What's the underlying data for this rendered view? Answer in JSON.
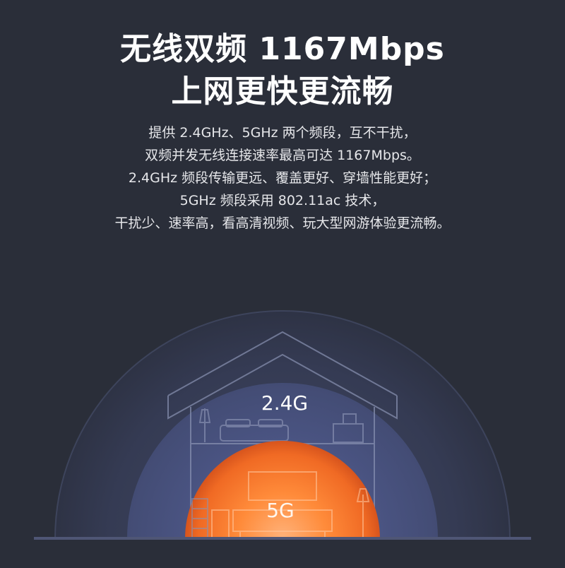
{
  "headline": {
    "line1": "无线双频 1167Mbps",
    "line2": "上网更快更流畅"
  },
  "description": {
    "lines": [
      "提供 2.4GHz、5GHz 两个频段，互不干扰，",
      "双频并发无线连接速率最高可达 1167Mbps。",
      "2.4GHz 频段传输更远、覆盖更好、穿墙性能更好；",
      "5GHz 频段采用 802.11ac 技术，",
      "干扰少、速率高，看高清视频、玩大型网游体验更流畅。"
    ]
  },
  "bands": {
    "band_24g": "2.4G",
    "band_5g": "5G"
  },
  "colors": {
    "background": "#2a2e39",
    "coverage_24g": "#4a5478",
    "coverage_5g": "#ff7a2a"
  }
}
